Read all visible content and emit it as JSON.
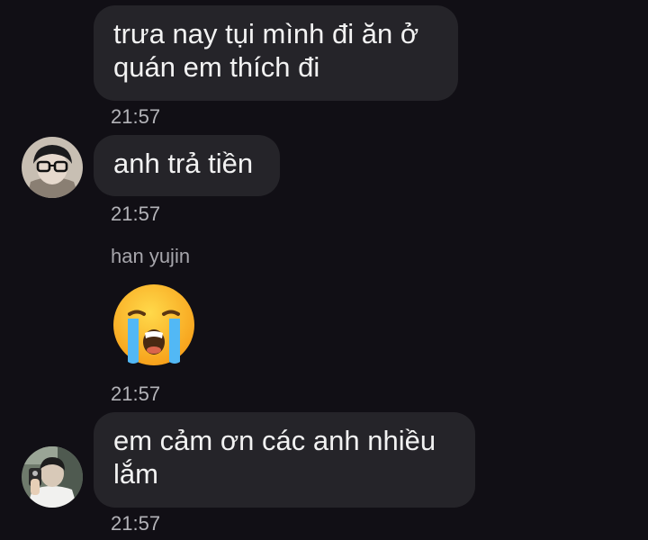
{
  "messages": [
    {
      "text": "trưa nay tụi mình đi ăn ở quán em thích đi",
      "time": "21:57"
    },
    {
      "text": "anh trả tiền",
      "time": "21:57",
      "avatar_icon": "avatar-glasses-icon"
    },
    {
      "sender": "han yujin",
      "emoji": "loudly-crying-face-icon",
      "time": "21:57"
    },
    {
      "text": "em cảm ơn các anh nhiều lắm",
      "time": "21:57",
      "avatar_icon": "avatar-mirror-selfie-icon"
    }
  ],
  "colors": {
    "background": "#110f15",
    "bubble": "#252429",
    "text": "#f2f2f2",
    "meta": "#b3b3b8"
  }
}
